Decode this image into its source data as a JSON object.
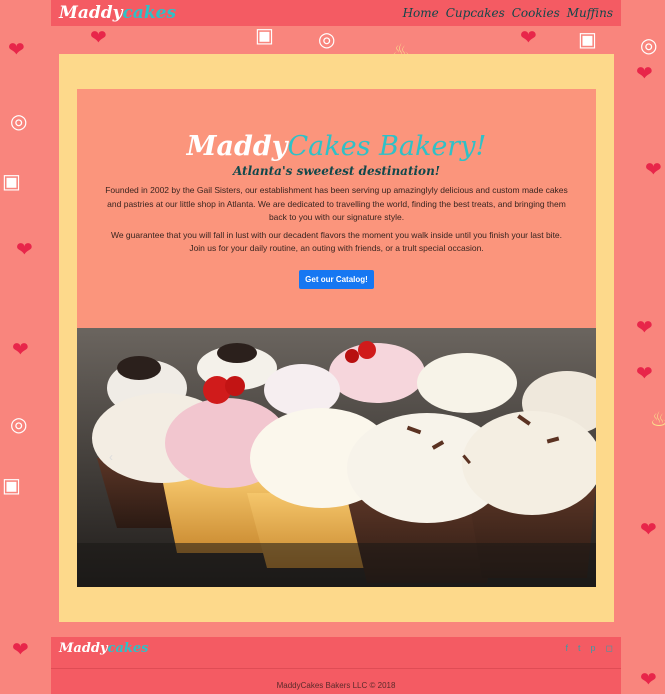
{
  "nav": {
    "brand_main": "Maddy",
    "brand_accent": "cakes",
    "links": [
      "Home",
      "Cupcakes",
      "Cookies",
      "Muffins"
    ]
  },
  "hero": {
    "title_main": "Maddy",
    "title_accent": "Cakes Bakery!",
    "subtitle": "Atlanta's sweetest destination!",
    "paragraph1": "Founded in 2002 by the Gail Sisters, our establishment has been serving up amazinglyly delicious and custom made cakes and pastries at our little shop in Atlanta. We are dedicated to travelling the world, finding the best treats, and bringing them back to you with our signature style.",
    "paragraph2": "We guarantee that you will fall in lust with our decadent flavors the moment you walk inside until you finish your last bite. Join us for your daily routine, an outing with friends, or a trult special occasion.",
    "cta_label": "Get our Catalog!"
  },
  "carousel": {
    "prev_icon": "chevron-left-icon"
  },
  "footer": {
    "brand_main": "Maddy",
    "brand_accent": "cakes",
    "social_icons": [
      "facebook-icon",
      "twitter-icon",
      "pinterest-icon",
      "instagram-icon"
    ],
    "copyright": "MaddyCakes Bakers LLC © 2018"
  },
  "colors": {
    "background": "#f9857d",
    "navbar": "#f45b63",
    "panel": "#fdd98b",
    "hero": "#fb957c",
    "accent": "#2ec1c7",
    "cta": "#1677f2"
  }
}
